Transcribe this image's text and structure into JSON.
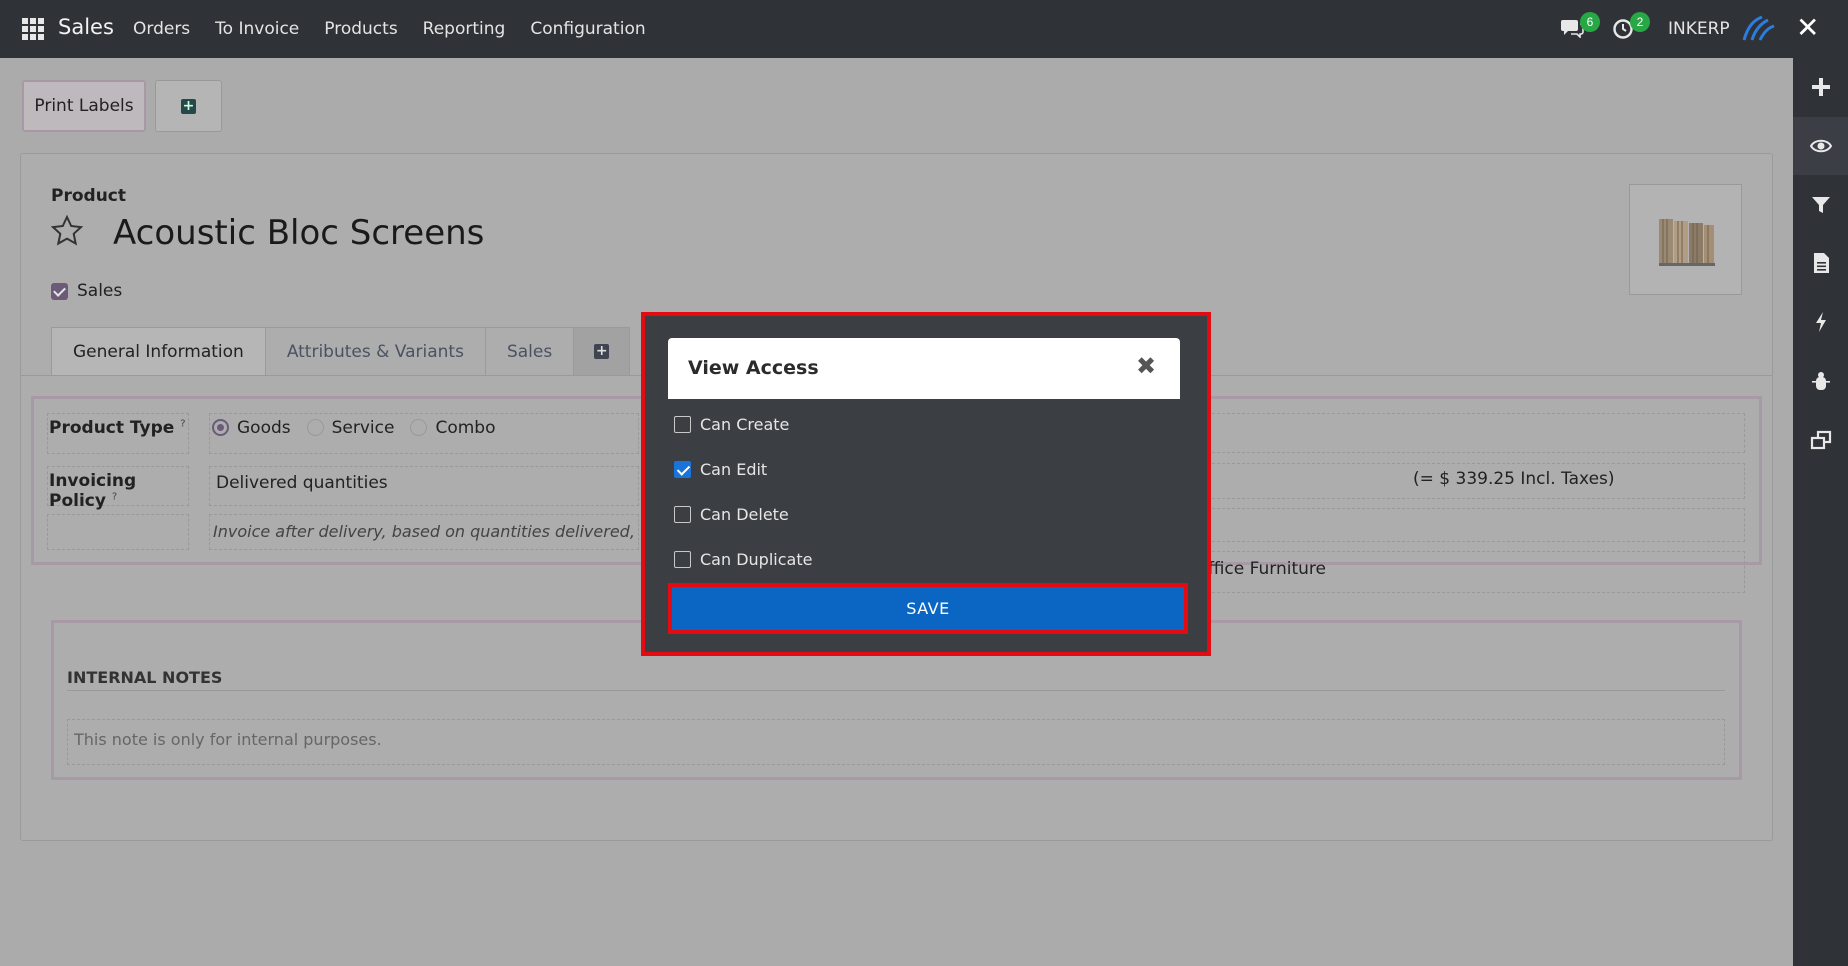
{
  "topbar": {
    "app_name": "Sales",
    "menu": [
      "Orders",
      "To Invoice",
      "Products",
      "Reporting",
      "Configuration"
    ],
    "messages_count": "6",
    "activities_count": "2",
    "company": "INKERP"
  },
  "control_panel": {
    "print_labels": "Print Labels"
  },
  "form": {
    "product_label": "Product",
    "product_name": "Acoustic Bloc Screens",
    "sales_checkbox_label": "Sales",
    "sales_checked": true,
    "tabs": [
      "General Information",
      "Attributes & Variants",
      "Sales"
    ],
    "product_type_label": "Product Type",
    "product_type_options": [
      "Goods",
      "Service",
      "Combo"
    ],
    "product_type_selected": "Goods",
    "invoicing_policy_label": "Invoicing Policy",
    "invoicing_policy_value": "Delivered quantities",
    "invoicing_note": "Invoice after delivery, based on quantities delivered, not",
    "price_incl_taxes": "(= $ 339.25 Incl. Taxes)",
    "category_partial": "ffice Furniture",
    "tooltip_mark": "?"
  },
  "notes": {
    "title": "INTERNAL NOTES",
    "placeholder": "This note is only for internal purposes."
  },
  "modal": {
    "title": "View Access",
    "options": [
      {
        "label": "Can Create",
        "checked": false
      },
      {
        "label": "Can Edit",
        "checked": true
      },
      {
        "label": "Can Delete",
        "checked": false
      },
      {
        "label": "Can Duplicate",
        "checked": false
      }
    ],
    "save_label": "SAVE"
  },
  "colors": {
    "topbar": "#2f3237",
    "accent_purple": "#6b5b78",
    "save_blue": "#0b66c3",
    "highlight_red": "#e20b12",
    "badge_green": "#28a745"
  },
  "icons": {
    "sidebar": [
      "plus-icon",
      "eye-icon",
      "filter-icon",
      "document-icon",
      "bolt-icon",
      "bug-icon",
      "windows-icon"
    ]
  }
}
